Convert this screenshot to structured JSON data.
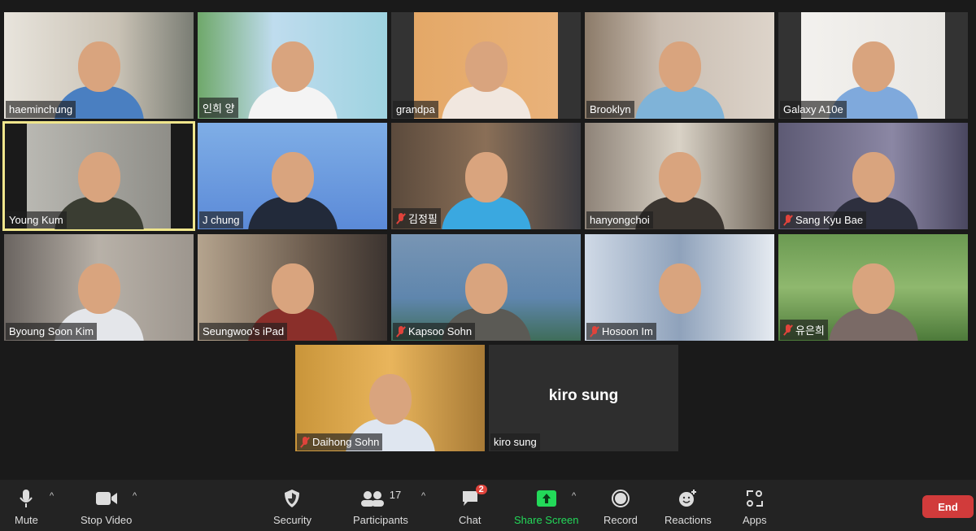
{
  "participants": [
    {
      "name": "haeminchung",
      "muted": false,
      "bg": "linear-gradient(90deg,#e8e4dc,#c9c2b5 60%,#7a7d74)",
      "shirt": "#4a7fc1"
    },
    {
      "name": "인희 양",
      "muted": false,
      "bg": "linear-gradient(90deg,#6fa86a,#bfdcee 40%,#9ed3e0)",
      "shirt": "#f4f4f4"
    },
    {
      "name": "grandpa",
      "muted": false,
      "bg": "linear-gradient(90deg,#333 12%,#e4a867 12%,#e9b27a 88%,#333 88%)",
      "shirt": "#f1e7df"
    },
    {
      "name": "Brooklyn",
      "muted": false,
      "bg": "linear-gradient(90deg,#8c7b69,#c8bcb0 40%,#ddd4ca)",
      "shirt": "#7fb3d8"
    },
    {
      "name": "Galaxy A10e",
      "muted": false,
      "bg": "linear-gradient(90deg,#333 12%,#f3f1ee 12%,#e8e6e2 88%,#333 88%)",
      "shirt": "#7fa9dc"
    },
    {
      "name": "Young Kum",
      "muted": false,
      "active": true,
      "bg": "linear-gradient(90deg,#1a1a1a 12%,#b9b8b2 12%,#8f8e88 88%,#1a1a1a 88%)",
      "shirt": "#3a3d32"
    },
    {
      "name": "J chung",
      "muted": false,
      "bg": "linear-gradient(180deg,#7faee6,#5b8ad8)",
      "shirt": "#222a3a"
    },
    {
      "name": "김정필",
      "muted": true,
      "bg": "linear-gradient(90deg,#5b4a3c,#8a6f57 50%,#3b3b40)",
      "shirt": "#3aa8e0"
    },
    {
      "name": "hanyongchoi",
      "muted": false,
      "bg": "linear-gradient(90deg,#8e8378,#d9d2c6 50%,#6f655a)",
      "shirt": "#3a3530"
    },
    {
      "name": "Sang Kyu Bae",
      "muted": true,
      "bg": "linear-gradient(90deg,#5d5a74,#8b87a4 60%,#4a4760)",
      "shirt": "#2d2f3e"
    },
    {
      "name": "Byoung Soon Kim",
      "muted": false,
      "bg": "linear-gradient(90deg,#6a6460,#b8b1a8 50%,#9d968e)",
      "shirt": "#e4e6ea"
    },
    {
      "name": "Seungwoo's iPad",
      "muted": false,
      "bg": "linear-gradient(90deg,#b5a48e,#6b5b4d 60%,#3c3430)",
      "shirt": "#8a2f2a"
    },
    {
      "name": "Kapsoo Sohn",
      "muted": true,
      "bg": "linear-gradient(180deg,#7895b4,#5f86ad 60%,#3f6d5a)",
      "shirt": "#5b5a55"
    },
    {
      "name": "Hosoon Im",
      "muted": true,
      "bg": "linear-gradient(90deg,#cfd9e6,#8fa2bb 50%,#e6ebf1)",
      "shirt": "transparent"
    },
    {
      "name": "유은희",
      "muted": true,
      "bg": "linear-gradient(180deg,#6b9a52,#8fb86e 50%,#4d7a3a)",
      "shirt": "#7a6a66"
    },
    {
      "name": "Daihong Sohn",
      "muted": true,
      "bg": "linear-gradient(90deg,#c9953a,#e9b55c 50%,#a77a36)",
      "shirt": "#dfe6f0"
    },
    {
      "name": "kiro sung",
      "muted": false,
      "video_off": true,
      "bg": "#2e2e2e"
    }
  ],
  "toolbar": {
    "mute": "Mute",
    "stop_video": "Stop Video",
    "security": "Security",
    "participants": "Participants",
    "participant_count": "17",
    "chat": "Chat",
    "chat_badge": "2",
    "share_screen": "Share Screen",
    "record": "Record",
    "reactions": "Reactions",
    "apps": "Apps",
    "end": "End",
    "share_color": "#23d959",
    "end_color": "#d13b3b"
  }
}
